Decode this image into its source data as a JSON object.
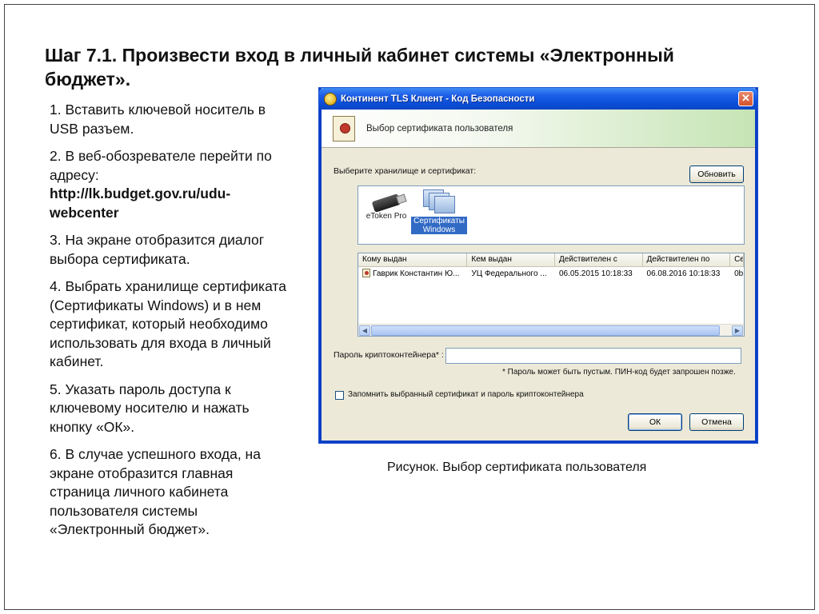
{
  "slide": {
    "title": "Шаг 7.1. Произвести вход в личный кабинет системы «Электронный бюджет».",
    "steps": [
      {
        "text": "1. Вставить ключевой носитель в USB разъем."
      },
      {
        "text": "2. В веб-обозревателе перейти по адресу:",
        "bold": "http://lk.budget.gov.ru/udu-webcenter"
      },
      {
        "text": "3. На экране отобразится диалог выбора сертификата."
      },
      {
        "text": "4. Выбрать хранилище сертификата (Сертификаты Windows) и в нем сертификат, который необходимо использовать для входа в личный кабинет."
      },
      {
        "text": "5. Указать пароль доступа к ключевому носителю и нажать кнопку «ОК»."
      },
      {
        "text": "6. В случае успешного входа, на экране отобразится главная страница личного кабинета пользователя системы «Электронный бюджет»."
      }
    ],
    "figure_caption": "Рисунок. Выбор сертификата пользователя"
  },
  "dialog": {
    "title": "Континент TLS Клиент - Код Безопасности",
    "close_label": "✕",
    "banner": "Выбор сертификата пользователя",
    "store_label": "Выберите хранилище и сертификат:",
    "refresh_button": "Обновить",
    "stores": [
      {
        "label": "eToken Pro",
        "icon": "usb-token-icon"
      },
      {
        "label": "Сертификаты Windows",
        "icon": "certificates-icon"
      }
    ],
    "table": {
      "columns": [
        "Кому выдан",
        "Кем выдан",
        "Действителен с",
        "Действителен по",
        "Се"
      ],
      "rows": [
        [
          "Гаврик Константин Ю...",
          "УЦ Федерального ...",
          "06.05.2015 10:18:33",
          "06.08.2016 10:18:33",
          "0b"
        ]
      ]
    },
    "password_label": "Пароль криптоконтейнера* :",
    "password_value": "",
    "password_note": "* Пароль может быть пустым. ПИН-код будет запрошен позже.",
    "remember_label": "Запомнить выбранный сертификат и пароль криптоконтейнера",
    "ok_button": "ОК",
    "cancel_button": "Отмена"
  }
}
